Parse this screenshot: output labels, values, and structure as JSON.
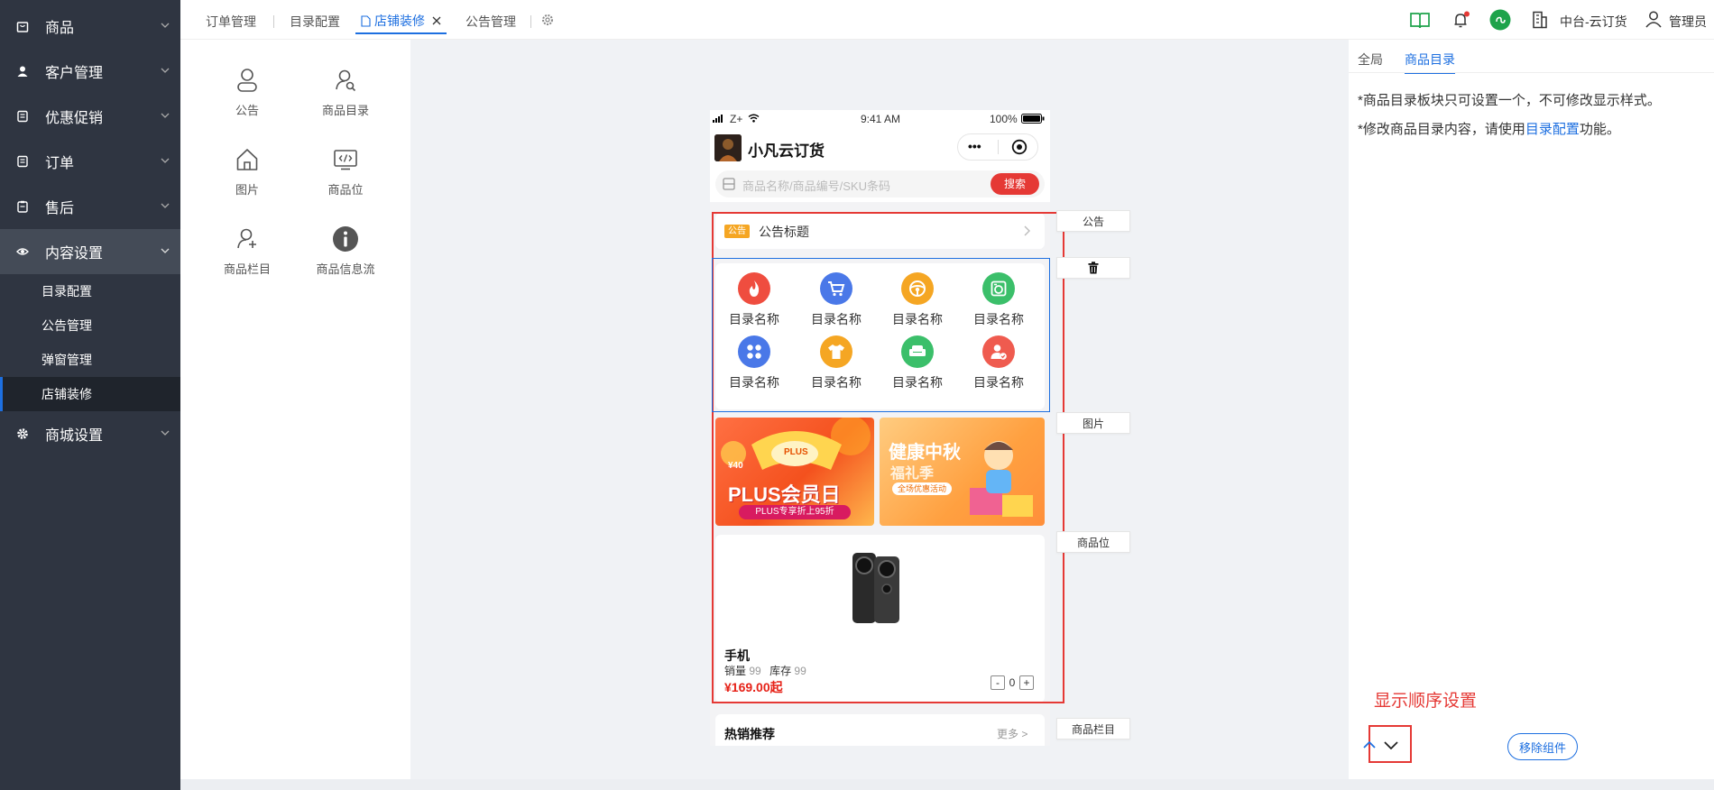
{
  "sidebar": {
    "items": [
      {
        "label": "商品",
        "icon": "bag-icon"
      },
      {
        "label": "客户管理",
        "icon": "user-icon"
      },
      {
        "label": "优惠促销",
        "icon": "list-icon"
      },
      {
        "label": "订单",
        "icon": "list-icon"
      },
      {
        "label": "售后",
        "icon": "clipboard-icon"
      },
      {
        "label": "内容设置",
        "icon": "eye-icon"
      },
      {
        "label": "商城设置",
        "icon": "gear-icon"
      }
    ],
    "sub_items": [
      "目录配置",
      "公告管理",
      "弹窗管理",
      "店铺装修"
    ]
  },
  "tabs": {
    "t1": "订单管理",
    "t2": "目录配置",
    "t3": "店铺装修",
    "t4": "公告管理"
  },
  "topbar": {
    "org": "中台-云订货",
    "user": "管理员"
  },
  "palette": [
    "公告",
    "商品目录",
    "图片",
    "商品位",
    "商品栏目",
    "商品信息流"
  ],
  "phone": {
    "carrier": "Z+",
    "time": "9:41 AM",
    "battery": "100%",
    "shop_name": "小凡云订货",
    "more": "•••",
    "search_placeholder": "商品名称/商品编号/SKU条码",
    "search_button": "搜索",
    "notice_tag": "公告",
    "notice_title": "公告标题",
    "catalog": [
      "目录名称",
      "目录名称",
      "目录名称",
      "目录名称",
      "目录名称",
      "目录名称",
      "目录名称",
      "目录名称"
    ],
    "banner1_title": "PLUS会员日",
    "banner1_sub": "PLUS专享折上95折",
    "banner1_badge": "PLUS",
    "banner1_price": "¥40",
    "banner2_title": "健康中秋",
    "banner2_sub": "福礼季",
    "banner2_small": "全场优惠活动",
    "product_name": "手机",
    "sales_label": "销量",
    "sales_value": "99",
    "stock_label": "库存",
    "stock_value": "99",
    "price": "¥169.00起",
    "qty_minus": "-",
    "qty": "0",
    "qty_plus": "+",
    "hot_title": "热销推荐",
    "hot_more": "更多 >"
  },
  "side_labels": {
    "notice": "公告",
    "image": "图片",
    "product_slot": "商品位",
    "product_column": "商品栏目"
  },
  "right_panel": {
    "tab_global": "全局",
    "tab_catalog": "商品目录",
    "line1": "*商品目录板块只可设置一个，不可修改显示样式。",
    "line2_pre": "*修改商品目录内容，请使用",
    "line2_link": "目录配置",
    "line2_post": "功能。",
    "order_annotation": "显示顺序设置",
    "remove_button": "移除组件"
  },
  "colors": {
    "accent": "#1d6fe0",
    "sidebar": "#2f3541",
    "highlight_red": "#e53935",
    "price_red": "#e62117"
  }
}
